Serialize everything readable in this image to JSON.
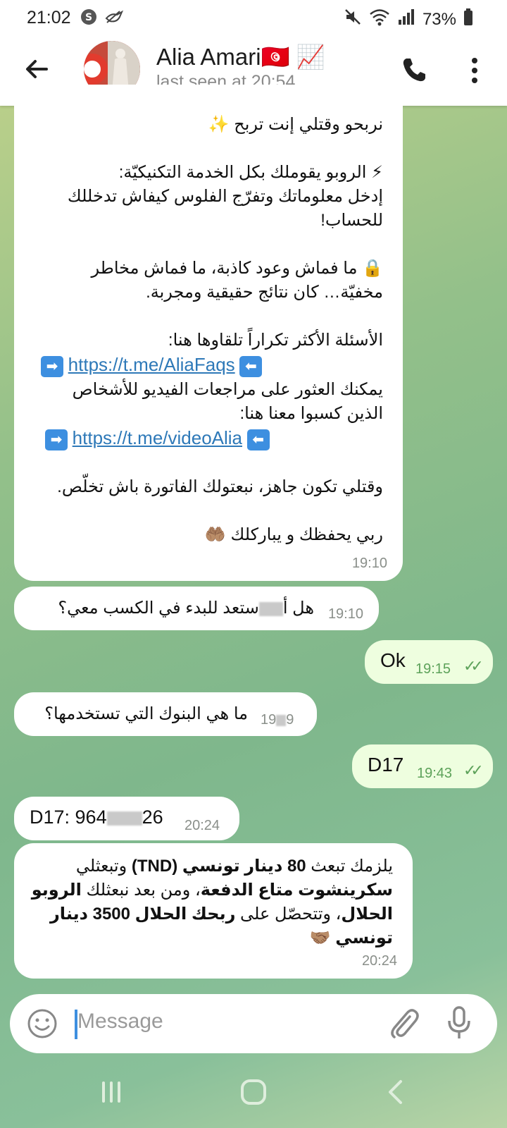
{
  "status": {
    "time": "21:02",
    "battery": "73%",
    "left_icons": [
      "skype-icon",
      "bird-icon"
    ],
    "right_icons": [
      "mute-icon",
      "wifi-icon",
      "signal-icon",
      "battery-icon"
    ]
  },
  "header": {
    "name": "Alia Amari",
    "flag_emoji": "🇹🇳",
    "trend_emoji": "📈",
    "last_seen": "last seen at 20:54"
  },
  "messages": {
    "long": {
      "line_top": "نربحو وقتلي إنت تربح ✨",
      "p1_l1": "⚡ الروبو يقوملك بكل الخدمة التكنيكيّة:",
      "p1_l2": "إدخل معلوماتك وتفرّج الفلوس كيفاش تدخللك",
      "p1_l3": "للحساب!",
      "p2_l1": "🔒 ما فماش وعود كاذبة، ما فماش مخاطر",
      "p2_l2": "مخفيّة… كان نتائج حقيقية ومجربة.",
      "p3_l1": "الأسئلة الأكثر تكراراً تلقاوها هنا:",
      "link1": "https://t.me/AliaFaqs",
      "p3_l3": "يمكنك العثور على مراجعات الفيديو للأشخاص",
      "p3_l4": "الذين كسبوا معنا هنا:",
      "link2": "https://t.me/videoAlia",
      "p4": "وقتلي تكون جاهز، نبعتولك الفاتورة باش تخلّص.",
      "p5": "ربي يحفظك و يباركلك 🤲🏽",
      "time": "19:10"
    },
    "m2": {
      "text_a": "هل أ",
      "text_b": "ستعد للبدء في الكسب معي؟",
      "time": "19:10"
    },
    "m3": {
      "text": "Ok",
      "time": "19:15",
      "ticks": "✓✓"
    },
    "m4": {
      "text": "ما هي البنوك التي تستخدمها؟",
      "time_a": "19",
      "time_b": "9"
    },
    "m5": {
      "text": "D17",
      "time": "19:43",
      "ticks": "✓✓"
    },
    "m6": {
      "text_a": "D17: 964",
      "text_b": "26",
      "time": "20:24"
    },
    "m7": {
      "l1_a": "يلزمك تبعث ",
      "l1_b": "80 دينار تونسي (TND)",
      "l1_c": " وتبعثلي",
      "l2_a": "سكرينشوت متاع الدفعة",
      "l2_b": "، ومن بعد نبعثلك ",
      "l2_c": "الروبو",
      "l3_a": "الحلال",
      "l3_b": "، وتتحصّل على ",
      "l3_c": "ربحك الحلال 3500 دينار",
      "l4_a": "تونسي",
      "l4_b": " 🤝🏽",
      "time": "20:24"
    }
  },
  "composer": {
    "placeholder": "Message"
  },
  "colors": {
    "incoming": "#ffffff",
    "outgoing": "#eefedf",
    "link": "#2e79b8",
    "tick": "#5da25a"
  }
}
